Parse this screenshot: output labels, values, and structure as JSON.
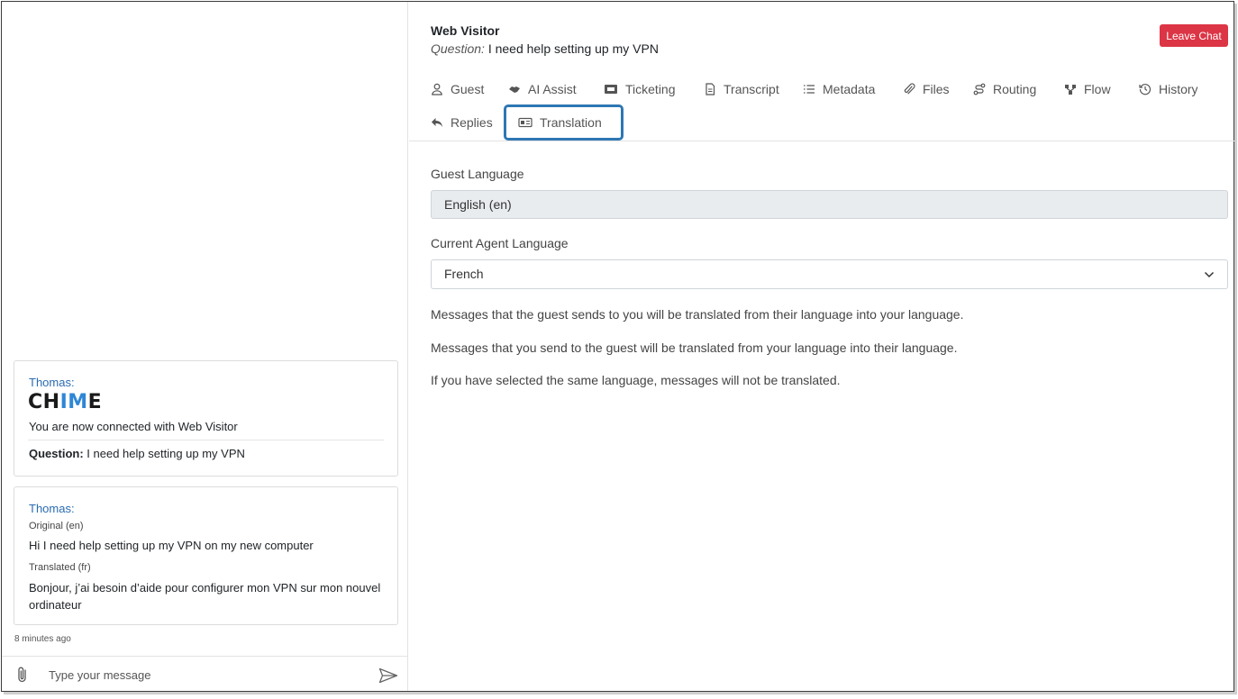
{
  "chat": {
    "messages": [
      {
        "sender": "Thomas:",
        "logo_text": "CHIME",
        "connected_text": "You are now connected with Web Visitor",
        "question_label": "Question:",
        "question_text": "I need help setting up my VPN"
      },
      {
        "sender": "Thomas:",
        "original_label": "Original (en)",
        "original_text": "Hi I need help setting up my VPN on my new computer",
        "translated_label": "Translated (fr)",
        "translated_text": "Bonjour, j’ai besoin d’aide pour configurer mon VPN sur mon nouvel ordinateur"
      }
    ],
    "timestamp": "8 minutes ago",
    "composer_placeholder": "Type your message"
  },
  "header": {
    "visitor_name": "Web Visitor",
    "question_label": "Question:",
    "question_text": "I need help setting up my VPN",
    "leave_button": "Leave Chat"
  },
  "tabs": [
    {
      "label": "Guest",
      "icon": "user-icon"
    },
    {
      "label": "AI Assist",
      "icon": "handshake-icon"
    },
    {
      "label": "Ticketing",
      "icon": "ticket-icon"
    },
    {
      "label": "Transcript",
      "icon": "document-icon"
    },
    {
      "label": "Metadata",
      "icon": "list-icon"
    },
    {
      "label": "Files",
      "icon": "paperclip-icon"
    },
    {
      "label": "Routing",
      "icon": "route-icon"
    },
    {
      "label": "Flow",
      "icon": "flow-icon"
    },
    {
      "label": "History",
      "icon": "history-icon"
    },
    {
      "label": "Replies",
      "icon": "reply-icon"
    },
    {
      "label": "Translation",
      "icon": "id-card-icon",
      "active": true
    }
  ],
  "translation": {
    "guest_language_label": "Guest Language",
    "guest_language_value": "English (en)",
    "agent_language_label": "Current Agent Language",
    "agent_language_value": "French",
    "info_lines": [
      "Messages that the guest sends to you will be translated from their language into your language.",
      "Messages that you send to the guest will be translated from your language into their language.",
      "If you have selected the same language, messages will not be translated."
    ]
  },
  "colors": {
    "leave_button": "#dc3545",
    "active_tab_border": "#2e77b3",
    "sender_name": "#2a6bb0",
    "logo_accent": "#2f86d6"
  }
}
